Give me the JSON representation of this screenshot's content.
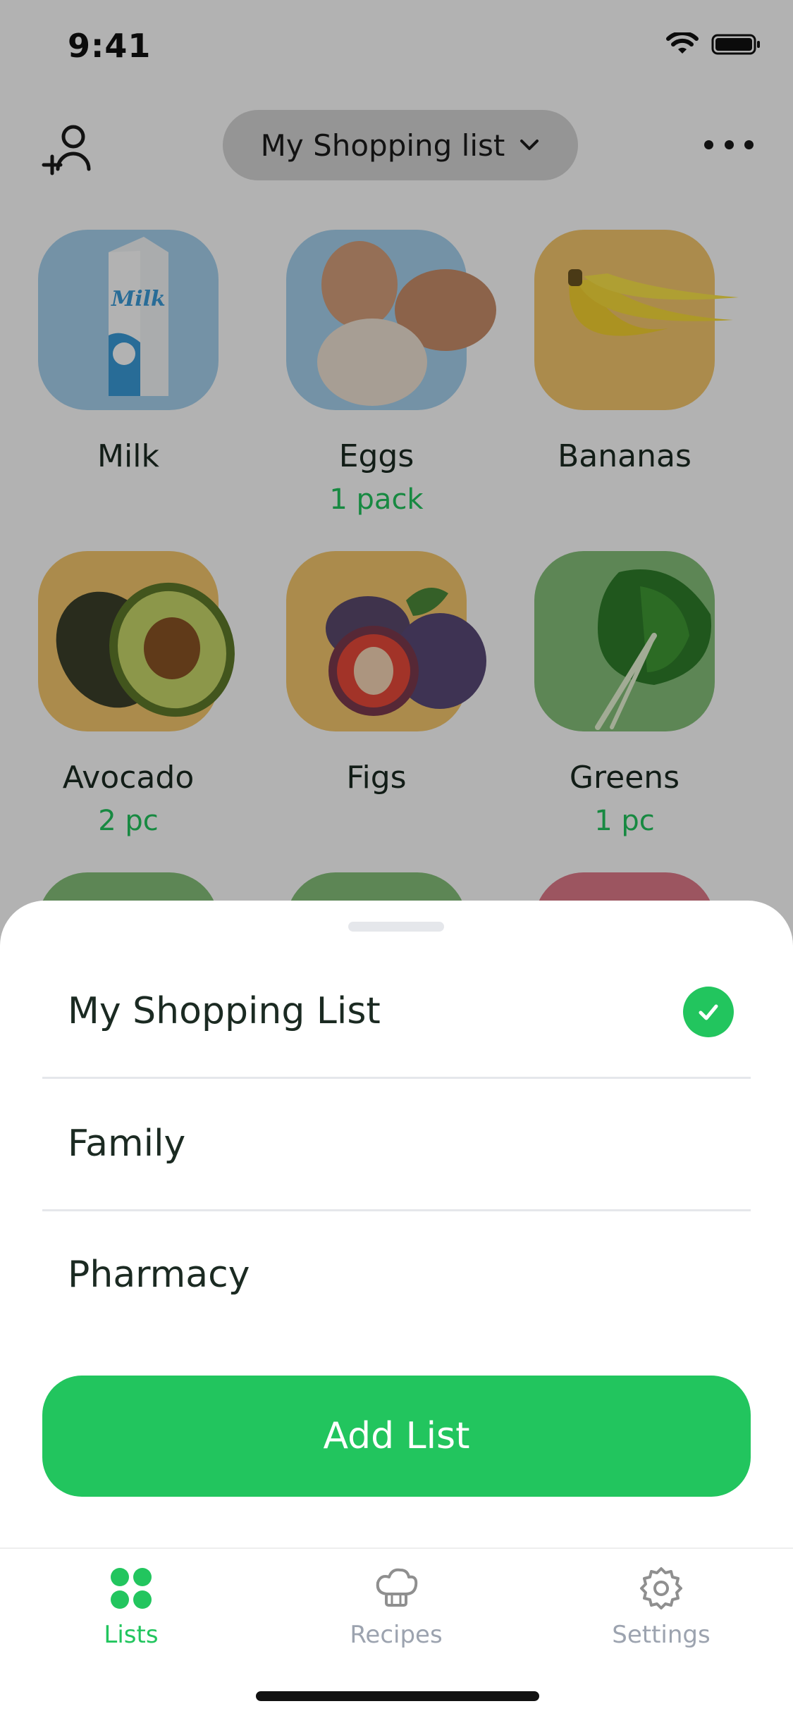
{
  "status_bar": {
    "time": "9:41"
  },
  "header": {
    "list_selector_label": "My Shopping list",
    "icons": [
      "add-user-icon",
      "chevron-down-icon",
      "more-icon"
    ]
  },
  "items": [
    {
      "name": "Milk",
      "qty": "",
      "tile_color": "#a6d2ee",
      "icon": "milk-carton-icon"
    },
    {
      "name": "Eggs",
      "qty": "1 pack",
      "tile_color": "#a6d2ee",
      "icon": "eggs-icon"
    },
    {
      "name": "Bananas",
      "qty": "",
      "tile_color": "#f5c86e",
      "icon": "bananas-icon"
    },
    {
      "name": "Avocado",
      "qty": "2 pc",
      "tile_color": "#f5c86e",
      "icon": "avocado-icon"
    },
    {
      "name": "Figs",
      "qty": "",
      "tile_color": "#f5c86e",
      "icon": "figs-icon"
    },
    {
      "name": "Greens",
      "qty": "1 pc",
      "tile_color": "#86c07a",
      "icon": "greens-icon"
    }
  ],
  "peek_tile_colors": [
    "#86c07a",
    "#86c07a",
    "#e07a8a"
  ],
  "sheet": {
    "lists": [
      {
        "label": "My Shopping List",
        "selected": true
      },
      {
        "label": "Family",
        "selected": false
      },
      {
        "label": "Pharmacy",
        "selected": false
      }
    ],
    "add_button_label": "Add List"
  },
  "tab_bar": {
    "tabs": [
      {
        "label": "Lists",
        "icon": "grid-icon",
        "active": true
      },
      {
        "label": "Recipes",
        "icon": "chef-hat-icon",
        "active": false
      },
      {
        "label": "Settings",
        "icon": "gear-icon",
        "active": false
      }
    ]
  },
  "colors": {
    "accent": "#22c55e",
    "overlay": "rgba(0,0,0,0.30)"
  }
}
